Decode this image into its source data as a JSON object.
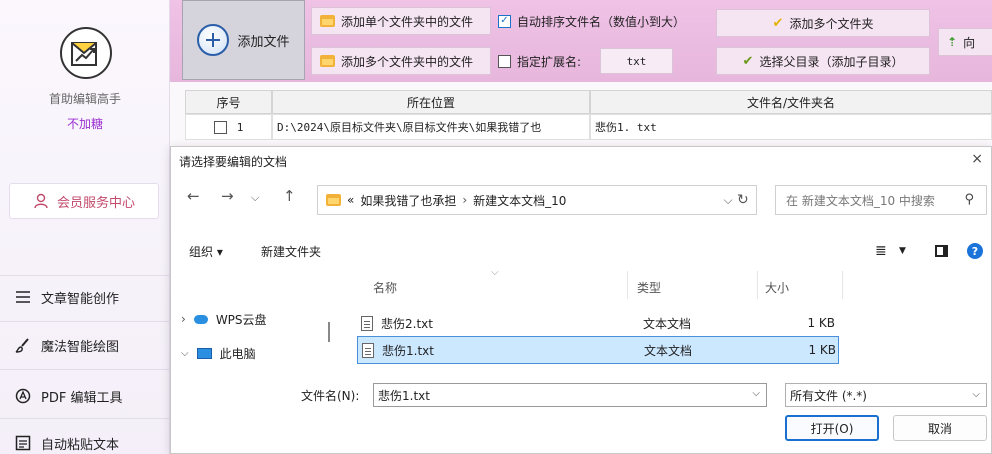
{
  "sidebar": {
    "app_name": "首助编辑高手",
    "status": "不加糖",
    "member_center": "会员服务中心",
    "items": [
      {
        "label": "文章智能创作",
        "icon": "menu-lines-icon"
      },
      {
        "label": "魔法智能绘图",
        "icon": "brush-icon"
      },
      {
        "label": "PDF 编辑工具",
        "icon": "pdf-icon"
      },
      {
        "label": "自动粘贴文本",
        "icon": "paste-icon"
      }
    ]
  },
  "toolbar": {
    "add_file": "添加文件",
    "add_single_folder": "添加单个文件夹中的文件",
    "add_multi_folder": "添加多个文件夹中的文件",
    "auto_sort": "自动排序文件名（数值小到大）",
    "auto_sort_checked": true,
    "specify_ext": "指定扩展名:",
    "specify_ext_checked": false,
    "ext_value": "txt",
    "add_multi_folders": "添加多个文件夹",
    "choose_parent": "选择父目录（添加子目录）",
    "direction": "向"
  },
  "table": {
    "headers": [
      "序号",
      "所在位置",
      "文件名/文件夹名"
    ],
    "rows": [
      {
        "index": "1",
        "location": "D:\\2024\\原目标文件夹\\原目标文件夹\\如果我错了也",
        "name": "悲伤1. txt"
      }
    ]
  },
  "dialog": {
    "title": "请选择要编辑的文档",
    "close": "×",
    "breadcrumb_prefix": "«",
    "breadcrumb": [
      "如果我错了也承担",
      "新建文本文档_10"
    ],
    "search_placeholder": "在 新建文本文档_10 中搜索",
    "organize": "组织 ▾",
    "new_folder": "新建文件夹",
    "nav_items": [
      {
        "label": "WPS云盘",
        "icon": "cloud-icon"
      },
      {
        "label": "此电脑",
        "icon": "computer-icon"
      }
    ],
    "columns": [
      "名称",
      "类型",
      "大小"
    ],
    "files": [
      {
        "name": "悲伤2.txt",
        "type": "文本文档",
        "size": "1 KB",
        "selected": false
      },
      {
        "name": "悲伤1.txt",
        "type": "文本文档",
        "size": "1 KB",
        "selected": true
      }
    ],
    "filename_label": "文件名(N):",
    "filename_value": "悲伤1.txt",
    "filetype_value": "所有文件 (*.*)",
    "open": "打开(O)",
    "cancel": "取消"
  },
  "colors": {
    "toolbar_bg": "#e9b8dd",
    "accent_purple": "#9a2fd0",
    "member_red": "#c24a6b",
    "selection_bg": "#cce8ff",
    "selection_border": "#4a90d9",
    "primary_button_border": "#1a6fd1"
  }
}
